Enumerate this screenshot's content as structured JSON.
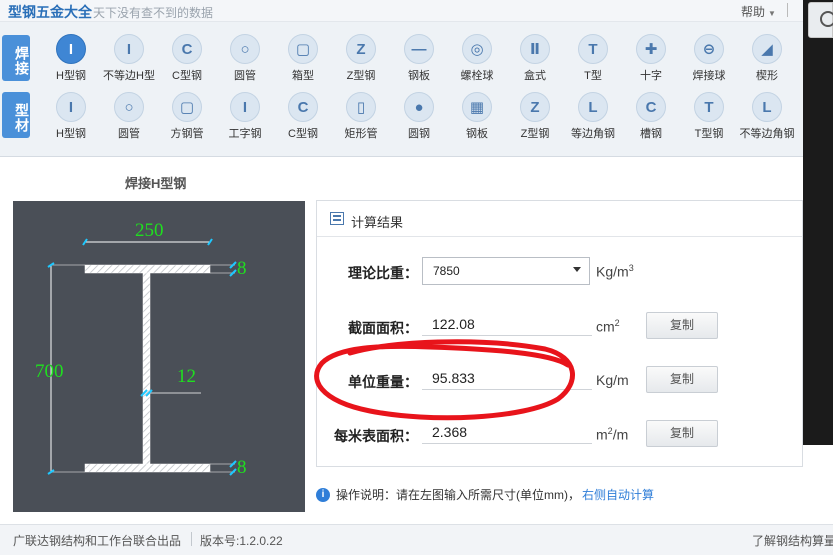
{
  "titlebar": {
    "app_title": "型钢五金大全",
    "slogan": "天下没有查不到的数据",
    "help": "帮助"
  },
  "toolbar": {
    "tab_weld": "焊接",
    "tab_section": "型材",
    "row1": [
      {
        "label": "H型钢",
        "glyph": "I",
        "icon": "h-beam-icon",
        "active": true
      },
      {
        "label": "不等边H型",
        "glyph": "I",
        "icon": "unequal-h-icon"
      },
      {
        "label": "C型钢",
        "glyph": "C",
        "icon": "c-channel-icon"
      },
      {
        "label": "圆管",
        "glyph": "○",
        "icon": "round-pipe-icon"
      },
      {
        "label": "箱型",
        "glyph": "▢",
        "icon": "box-section-icon"
      },
      {
        "label": "Z型钢",
        "glyph": "Z",
        "icon": "z-section-icon"
      },
      {
        "label": "钢板",
        "glyph": "—",
        "icon": "steel-plate-icon"
      },
      {
        "label": "螺栓球",
        "glyph": "◎",
        "icon": "bolt-ball-icon"
      },
      {
        "label": "盒式",
        "glyph": "Ⅱ",
        "icon": "box-type-icon"
      },
      {
        "label": "T型",
        "glyph": "T",
        "icon": "t-section-icon"
      },
      {
        "label": "十字",
        "glyph": "✚",
        "icon": "cross-section-icon"
      },
      {
        "label": "焊接球",
        "glyph": "⊖",
        "icon": "welded-ball-icon"
      },
      {
        "label": "楔形",
        "glyph": "◢",
        "icon": "wedge-icon"
      }
    ],
    "row2": [
      {
        "label": "H型钢",
        "glyph": "I",
        "icon": "h-beam-icon"
      },
      {
        "label": "圆管",
        "glyph": "○",
        "icon": "round-pipe-icon"
      },
      {
        "label": "方钢管",
        "glyph": "▢",
        "icon": "square-tube-icon"
      },
      {
        "label": "工字钢",
        "glyph": "I",
        "icon": "i-beam-icon"
      },
      {
        "label": "C型钢",
        "glyph": "C",
        "icon": "c-channel-icon"
      },
      {
        "label": "矩形管",
        "glyph": "▯",
        "icon": "rect-tube-icon"
      },
      {
        "label": "圆钢",
        "glyph": "●",
        "icon": "round-bar-icon"
      },
      {
        "label": "钢板",
        "glyph": "▦",
        "icon": "steel-plate-icon"
      },
      {
        "label": "Z型钢",
        "glyph": "Z",
        "icon": "z-section-icon"
      },
      {
        "label": "等边角钢",
        "glyph": "L",
        "icon": "equal-angle-icon"
      },
      {
        "label": "槽钢",
        "glyph": "C",
        "icon": "channel-icon"
      },
      {
        "label": "T型钢",
        "glyph": "T",
        "icon": "t-beam-icon"
      },
      {
        "label": "不等边角钢",
        "glyph": "L",
        "icon": "unequal-angle-icon"
      }
    ]
  },
  "section_title": "焊接H型钢",
  "diagram": {
    "width": "250",
    "height": "700",
    "web_thickness": "12",
    "top_flange": "8",
    "bottom_flange": "8"
  },
  "result": {
    "title": "计算结果",
    "density_label": "理论比重：",
    "density_value": "7850",
    "density_unit": "Kg/m",
    "density_unit_sup": "3",
    "area_label": "截面面积：",
    "area_value": "122.08",
    "area_unit": "cm",
    "area_unit_sup": "2",
    "weight_label": "单位重量：",
    "weight_value": "95.833",
    "weight_unit": "Kg/m",
    "surface_label": "每米表面积：",
    "surface_value": "2.368",
    "surface_unit": "m",
    "surface_unit_sup": "2",
    "surface_unit_tail": "/m",
    "copy": "复制"
  },
  "note": {
    "text": "操作说明：请在左图输入所需尺寸(单位mm)，",
    "link": "右侧自动计算"
  },
  "status": {
    "company": "广联达钢结构和工作台联合出品",
    "version": "版本号:1.2.0.22",
    "right": "了解钢结构算量"
  },
  "colors": {
    "accent": "#3f86d4",
    "diagram_bg": "#4a4f57",
    "dimension": "#1fe01f",
    "scribble": "#e8141b"
  }
}
